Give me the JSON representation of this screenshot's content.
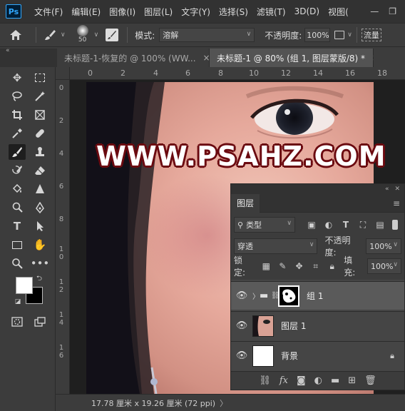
{
  "app_logo": "Ps",
  "menu": [
    "文件(F)",
    "编辑(E)",
    "图像(I)",
    "图层(L)",
    "文字(Y)",
    "选择(S)",
    "滤镜(T)",
    "3D(D)",
    "视图("
  ],
  "options": {
    "brush_size": "50",
    "mode_label": "模式:",
    "mode_value": "溶解",
    "opacity_label": "不透明度:",
    "opacity_value": "100%",
    "flow_label": "流量"
  },
  "tabs": [
    {
      "label": "未标题-1-恢复的 @ 100% (WW...",
      "close": "×",
      "active": false
    },
    {
      "label": "未标题-1 @ 80% (组 1, 图层蒙版/8) *",
      "close": "×",
      "active": true
    }
  ],
  "ruler_top": [
    "0",
    "2",
    "4",
    "6",
    "8",
    "10",
    "12",
    "14",
    "16",
    "18"
  ],
  "ruler_left": [
    "0",
    "2",
    "4",
    "6",
    "8",
    "1\n0",
    "1\n2",
    "1\n4",
    "1\n6"
  ],
  "watermark": "WWW.PSAHZ.COM",
  "status": "17.78 厘米 x 19.26 厘米 (72 ppi)",
  "layers_panel": {
    "title": "图层",
    "filter_kind": "类型",
    "blend_mode": "穿透",
    "opacity_label": "不透明度:",
    "opacity_value": "100%",
    "lock_label": "锁定:",
    "fill_label": "填充:",
    "fill_value": "100%",
    "layers": [
      {
        "name": "组 1",
        "type": "group",
        "selected": true
      },
      {
        "name": "图层 1",
        "type": "image",
        "selected": false
      },
      {
        "name": "背景",
        "type": "background",
        "selected": false
      }
    ]
  },
  "colors": {
    "foreground": "#ffffff",
    "background": "#000000",
    "accent": "#31a8ff"
  }
}
